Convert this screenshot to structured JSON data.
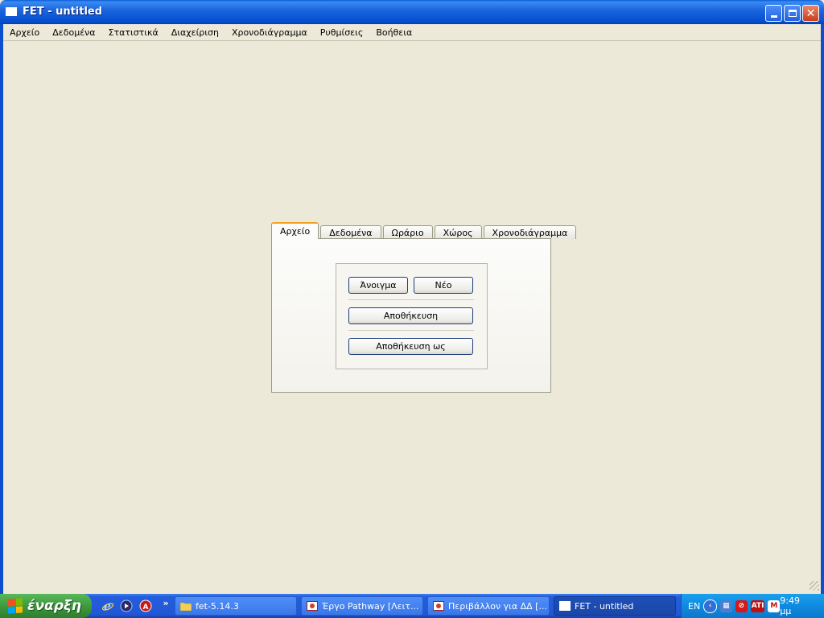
{
  "window": {
    "title": "FET - untitled"
  },
  "menu": [
    "Αρχείο",
    "Δεδομένα",
    "Στατιστικά",
    "Διαχείριση",
    "Χρονοδιάγραμμα",
    "Ρυθμίσεις",
    "Βοήθεια"
  ],
  "tabs": [
    "Αρχείο",
    "Δεδομένα",
    "Ωράριο",
    "Χώρος",
    "Χρονοδιάγραμμα"
  ],
  "active_tab": "Αρχείο",
  "file_panel": {
    "open": "Άνοιγμα",
    "new": "Νέο",
    "save": "Αποθήκευση",
    "save_as": "Αποθήκευση ως"
  },
  "taskbar": {
    "start": "έναρξη",
    "quicklaunch_more": "»",
    "tasks": [
      "fet-5.14.3",
      "Έργο Pathway [Λειτ...",
      "Περιβάλλον για ΔΔ [...",
      "FET - untitled"
    ],
    "active_task": "FET - untitled",
    "tray": {
      "language": "EN",
      "ati": "ATI",
      "m": "M",
      "clock": "9:49 μμ"
    }
  },
  "colors": {
    "titlebar": "#0a5fd8",
    "active_tab_accent": "#f4a21e",
    "taskbar": "#245ddb",
    "start": "#3d9a3e"
  }
}
